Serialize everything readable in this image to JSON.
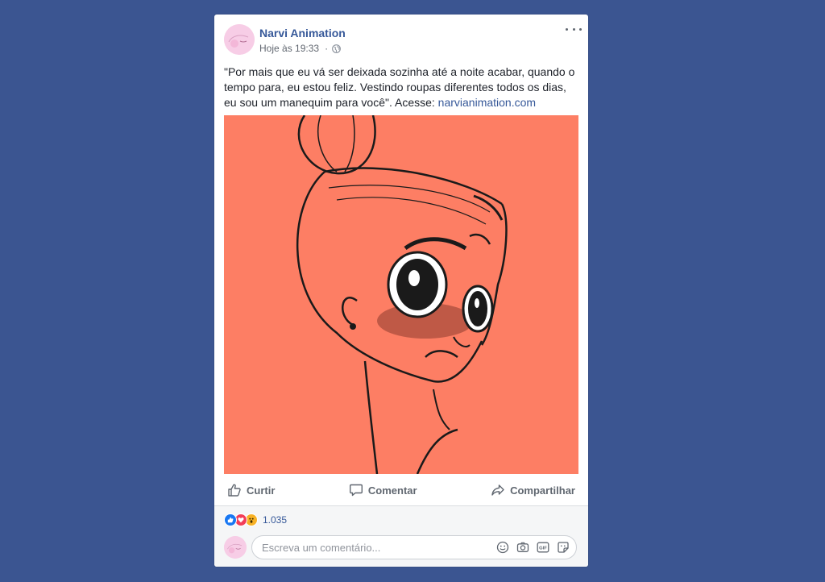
{
  "post": {
    "page_name": "Narvi Animation",
    "timestamp": "Hoje às 19:33",
    "separator": "·",
    "privacy_icon": "globe-icon",
    "text_before_link": "\"Por mais que eu vá ser deixada sozinha até a noite acabar, quando o tempo para, eu estou feliz. Vestindo roupas diferentes todos os dias, eu sou um manequim para você\". Acesse: ",
    "link_text": "narvianimation.com",
    "image_subject": "sketch illustration of a girl with a hair bun on coral background",
    "image_background": "#fd7e64"
  },
  "actions": {
    "like_label": "Curtir",
    "comment_label": "Comentar",
    "share_label": "Compartilhar"
  },
  "reactions": {
    "types": [
      "like",
      "love",
      "wow"
    ],
    "colors": {
      "like": "#1877f2",
      "love": "#f33e58",
      "wow": "#f7b125"
    },
    "count": "1.035"
  },
  "comment": {
    "placeholder": "Escreva um comentário...",
    "icons": [
      "emoji-icon",
      "camera-icon",
      "gif-icon",
      "sticker-icon"
    ]
  },
  "colors": {
    "page_background": "#3b5591",
    "link": "#365899",
    "card": "#ffffff"
  }
}
